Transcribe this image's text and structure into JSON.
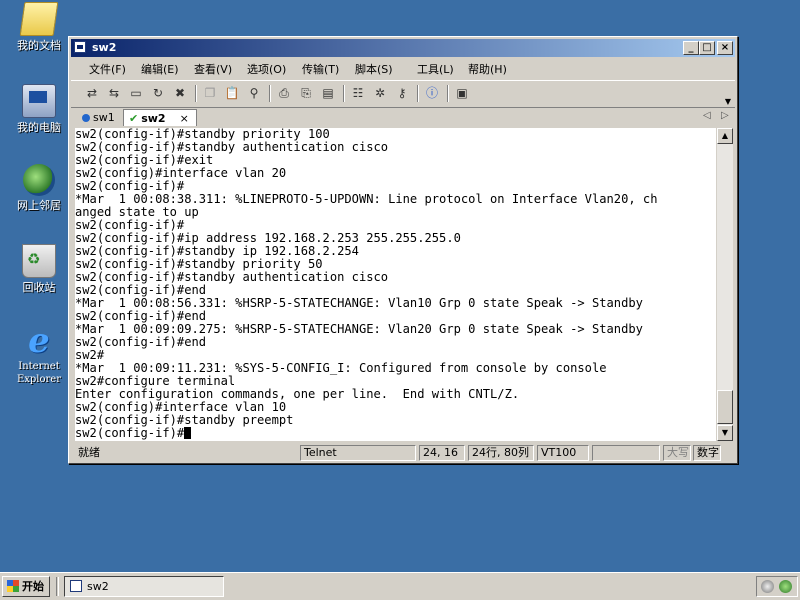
{
  "desktop": {
    "icons": [
      {
        "label": "我的文档"
      },
      {
        "label": "我的电脑"
      },
      {
        "label": "网上邻居"
      },
      {
        "label": "回收站"
      },
      {
        "label": "Internet Explorer"
      }
    ]
  },
  "window": {
    "title": "sw2",
    "controls": {
      "minimize": "_",
      "maximize": "□",
      "close": "×"
    }
  },
  "menu": [
    "文件(F)",
    "编辑(E)",
    "查看(V)",
    "选项(O)",
    "传输(T)",
    "脚本(S)",
    "工具(L)",
    "帮助(H)"
  ],
  "tabs": [
    {
      "label": "sw1",
      "active": false
    },
    {
      "label": "sw2",
      "active": true,
      "close": "×"
    }
  ],
  "tab_nav": {
    "prev": "◁",
    "next": "▷"
  },
  "terminal": {
    "lines": [
      "sw2(config-if)#standby priority 100",
      "sw2(config-if)#standby authentication cisco",
      "sw2(config-if)#exit",
      "sw2(config)#interface vlan 20",
      "sw2(config-if)#",
      "*Mar  1 00:08:38.311: %LINEPROTO-5-UPDOWN: Line protocol on Interface Vlan20, ch",
      "anged state to up",
      "sw2(config-if)#",
      "sw2(config-if)#ip address 192.168.2.253 255.255.255.0",
      "sw2(config-if)#standby ip 192.168.2.254",
      "sw2(config-if)#standby priority 50",
      "sw2(config-if)#standby authentication cisco",
      "sw2(config-if)#end",
      "*Mar  1 00:08:56.331: %HSRP-5-STATECHANGE: Vlan10 Grp 0 state Speak -> Standby",
      "sw2(config-if)#end",
      "*Mar  1 00:09:09.275: %HSRP-5-STATECHANGE: Vlan20 Grp 0 state Speak -> Standby",
      "sw2(config-if)#end",
      "sw2#",
      "*Mar  1 00:09:11.231: %SYS-5-CONFIG_I: Configured from console by console",
      "sw2#configure terminal",
      "Enter configuration commands, one per line.  End with CNTL/Z.",
      "sw2(config)#interface vlan 10",
      "sw2(config-if)#standby preempt",
      "sw2(config-if)#"
    ]
  },
  "statusbar": {
    "ready": "就绪",
    "protocol": "Telnet",
    "cursor_pos": "24, 16",
    "size": "24行, 80列",
    "emulation": "VT100",
    "blank": "",
    "caps": "大写",
    "numlock": "数字"
  },
  "taskbar": {
    "start_label": "开始",
    "task_label": "sw2"
  },
  "colors": {
    "desktop": "#3a6ea5",
    "title_start": "#0a246a",
    "title_end": "#a6caf0",
    "chrome": "#d4d0c8"
  }
}
